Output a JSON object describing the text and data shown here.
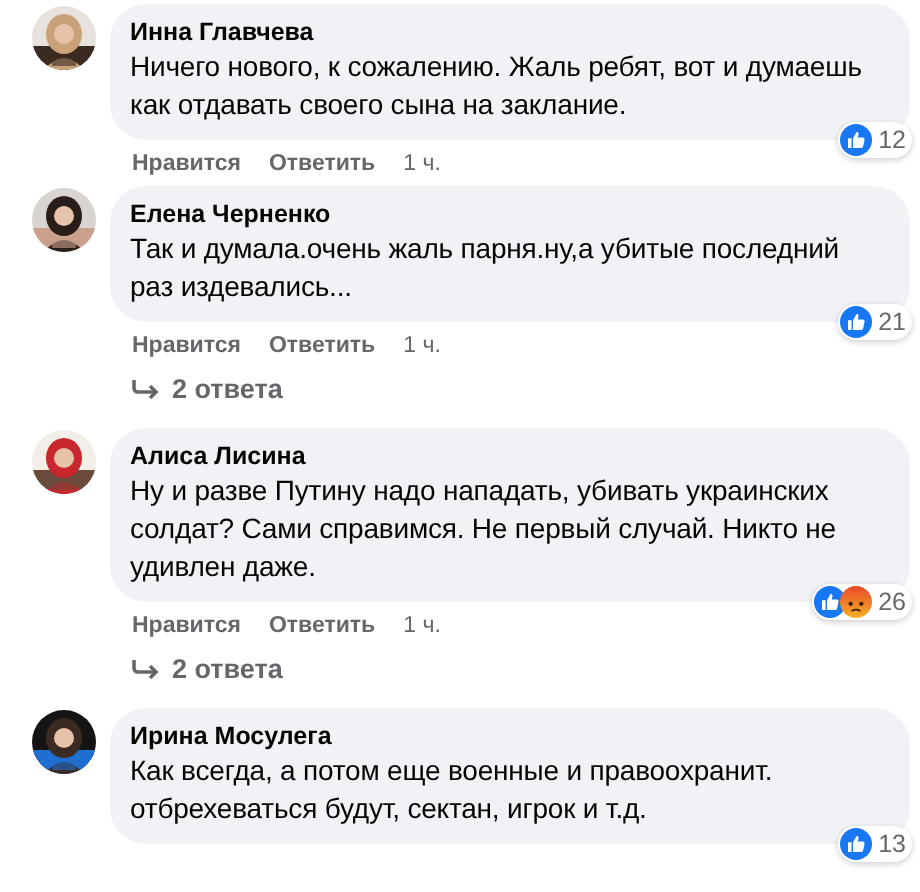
{
  "comments": [
    {
      "author": "Инна Главчева",
      "text": "Ничего нового, к сожалению. Жаль ребят, вот и думаешь как отдавать своего сына на заклание.",
      "reactions": [
        {
          "kind": "like"
        }
      ],
      "reaction_count": "12",
      "like": "Нравится",
      "reply": "Ответить",
      "time": "1 ч."
    },
    {
      "author": "Елена Черненко",
      "text": "Так и думала.очень жаль парня.ну,а убитые последний раз издевались...",
      "reactions": [
        {
          "kind": "like"
        }
      ],
      "reaction_count": "21",
      "like": "Нравится",
      "reply": "Ответить",
      "time": "1 ч.",
      "replies": "2 ответа"
    },
    {
      "author": "Алиса Лисина",
      "text": "Ну и разве Путину надо нападать, убивать украинских солдат? Сами справимся. Не первый случай. Никто не удивлен даже.",
      "reactions": [
        {
          "kind": "like"
        },
        {
          "kind": "angry"
        }
      ],
      "reaction_count": "26",
      "like": "Нравится",
      "reply": "Ответить",
      "time": "1 ч.",
      "replies": "2 ответа"
    },
    {
      "author": "Ирина Мосулега",
      "text": "Как всегда, а потом еще военные и правоохранит. отбрехеваться будут, сектан, игрок и т.д.",
      "reactions": [
        {
          "kind": "like"
        }
      ],
      "reaction_count": "13"
    }
  ]
}
